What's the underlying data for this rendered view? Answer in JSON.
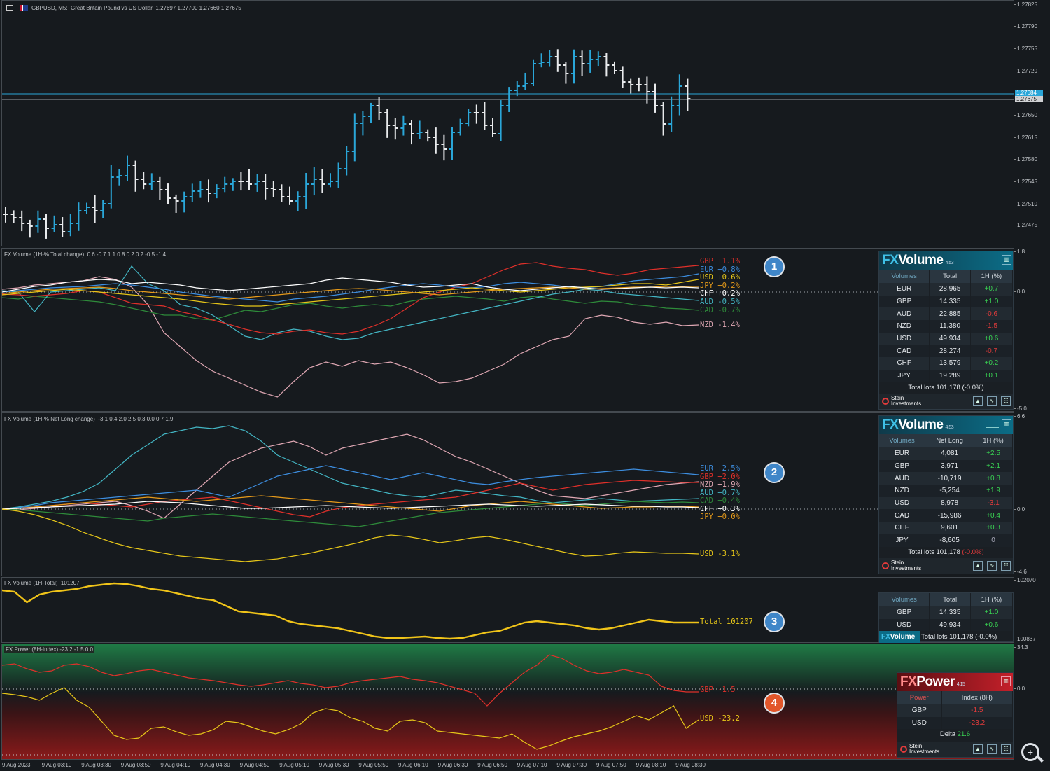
{
  "chart_title": "GBPUSD, M5:  Great Britain Pound vs US Dollar  1.27697 1.27700 1.27660 1.27675",
  "price_axis": [
    "1.27825",
    "1.27790",
    "1.27755",
    "1.27720",
    "1.27650",
    "1.27615",
    "1.27580",
    "1.27545",
    "1.27510",
    "1.27475"
  ],
  "price_tags": [
    "1.27684",
    "1.27675"
  ],
  "pane1": {
    "title": "FX Volume (1H-% Total change)  0.6 -0.7 1.1 0.8 0.2 0.2 -0.5 -1.4",
    "axis": [
      "1.8",
      "0.0",
      "-5.0"
    ],
    "labels": [
      {
        "text": "GBP +1.1%",
        "color": "#e0302a"
      },
      {
        "text": "EUR +0.8%",
        "color": "#3d8ee0"
      },
      {
        "text": "USD +0.6%",
        "color": "#e6c619"
      },
      {
        "text": "JPY +0.2%",
        "color": "#e69a1a"
      },
      {
        "text": "CHF +0.2%",
        "color": "#ffffff"
      },
      {
        "text": "AUD -0.5%",
        "color": "#43b6c4"
      },
      {
        "text": "CAD -0.7%",
        "color": "#2e8b3a"
      },
      {
        "text": "NZD -1.4%",
        "color": "#e0a8b4"
      }
    ],
    "badge": "1"
  },
  "pane2": {
    "title": "FX Volume (1H-% Net Long change)  -3.1 0.4 2.0 2.5 0.3 0.0 0.7 1.9",
    "axis": [
      "6.6",
      "0.0",
      "-4.6"
    ],
    "labels": [
      {
        "text": "EUR +2.5%",
        "color": "#3d8ee0"
      },
      {
        "text": "GBP +2.0%",
        "color": "#e0302a"
      },
      {
        "text": "NZD +1.9%",
        "color": "#e0a8b4"
      },
      {
        "text": "AUD +0.7%",
        "color": "#43b6c4"
      },
      {
        "text": "CAD +0.4%",
        "color": "#2e8b3a"
      },
      {
        "text": "CHF +0.3%",
        "color": "#ffffff"
      },
      {
        "text": "JPY +0.0%",
        "color": "#e69a1a"
      },
      {
        "text": "USD -3.1%",
        "color": "#e6c619"
      }
    ],
    "badge": "2"
  },
  "pane3": {
    "title": "FX Volume (1H-Total)  101207",
    "axis": [
      "102070",
      "100837"
    ],
    "label": "Total 101207",
    "badge": "3"
  },
  "pane4": {
    "title": "FX Power (8H-Index) -23.2 -1.5 0.0",
    "axis": [
      "34.3",
      "0.0"
    ],
    "labels": [
      {
        "text": "GBP -1.5",
        "color": "#e0302a"
      },
      {
        "text": "USD -23.2",
        "color": "#e6c619"
      }
    ],
    "badge": "4"
  },
  "widget1": {
    "logo_fx": "FX",
    "logo_rest": "Volume",
    "version": "4.53",
    "headers": [
      "Volumes",
      "Total",
      "1H (%)"
    ],
    "rows": [
      [
        "EUR",
        "28,965",
        "+0.7"
      ],
      [
        "GBP",
        "14,335",
        "+1.0"
      ],
      [
        "AUD",
        "22,885",
        "-0.6"
      ],
      [
        "NZD",
        "11,380",
        "-1.5"
      ],
      [
        "USD",
        "49,934",
        "+0.6"
      ],
      [
        "CAD",
        "28,274",
        "-0.7"
      ],
      [
        "CHF",
        "13,579",
        "+0.2"
      ],
      [
        "JPY",
        "19,289",
        "+0.1"
      ]
    ],
    "footer": "Total lots 101,178 (-0.0%)",
    "brand_line1": "Stein",
    "brand_line2": "Investments"
  },
  "widget2": {
    "logo_fx": "FX",
    "logo_rest": "Volume",
    "version": "4.53",
    "headers": [
      "Volumes",
      "Net Long",
      "1H (%)"
    ],
    "rows": [
      [
        "EUR",
        "4,081",
        "+2.5"
      ],
      [
        "GBP",
        "3,971",
        "+2.1"
      ],
      [
        "AUD",
        "-10,719",
        "+0.8"
      ],
      [
        "NZD",
        "-5,254",
        "+1.9"
      ],
      [
        "USD",
        "8,978",
        "-3.1"
      ],
      [
        "CAD",
        "-15,986",
        "+0.4"
      ],
      [
        "CHF",
        "9,601",
        "+0.3"
      ],
      [
        "JPY",
        "-8,605",
        "0"
      ]
    ],
    "footer_prefix": "Total lots 101,178 ",
    "footer_change": "(-0.0%)",
    "brand_line1": "Stein",
    "brand_line2": "Investments"
  },
  "widget3": {
    "headers": [
      "Volumes",
      "Total",
      "1H (%)"
    ],
    "rows": [
      [
        "GBP",
        "14,335",
        "+1.0"
      ],
      [
        "USD",
        "49,934",
        "+0.6"
      ]
    ],
    "logo_fx": "FX",
    "logo_rest": "Volume",
    "footer": "Total lots 101,178 (-0.0%)"
  },
  "widget4": {
    "logo_fx": "FX",
    "logo_rest": "Power",
    "version": "4.15",
    "headers": [
      "Power",
      "Index (8H)"
    ],
    "rows": [
      [
        "GBP",
        "-1.5"
      ],
      [
        "USD",
        "-23.2"
      ]
    ],
    "delta_label": "Delta",
    "delta_value": "21.6",
    "brand_line1": "Stein",
    "brand_line2": "Investments"
  },
  "time_axis": [
    "9 Aug 2023",
    "9 Aug 03:10",
    "9 Aug 03:30",
    "9 Aug 03:50",
    "9 Aug 04:10",
    "9 Aug 04:30",
    "9 Aug 04:50",
    "9 Aug 05:10",
    "9 Aug 05:30",
    "9 Aug 05:50",
    "9 Aug 06:10",
    "9 Aug 06:30",
    "9 Aug 06:50",
    "9 Aug 07:10",
    "9 Aug 07:30",
    "9 Aug 07:50",
    "9 Aug 08:10",
    "9 Aug 08:30"
  ],
  "colors": {
    "bull": "#2aa6d8",
    "bear": "#e8eaec",
    "price_line": "#2aa6d8"
  }
}
